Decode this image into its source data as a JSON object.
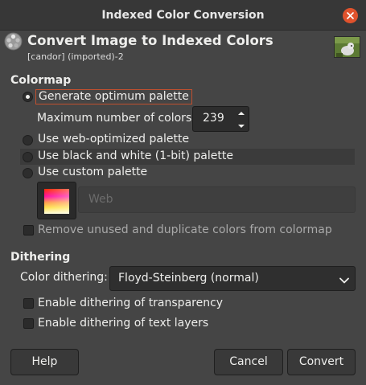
{
  "window": {
    "title": "Indexed Color Conversion"
  },
  "header": {
    "title": "Convert Image to Indexed Colors",
    "subtitle": "[candor] (imported)-2"
  },
  "colormap": {
    "section_label": "Colormap",
    "options": [
      {
        "label": "Generate optimum palette",
        "checked": true
      },
      {
        "label": "Use web-optimized palette",
        "checked": false
      },
      {
        "label": "Use black and white (1-bit) palette",
        "checked": false
      },
      {
        "label": "Use custom palette",
        "checked": false
      }
    ],
    "max_colors_label": "Maximum number of colors:",
    "max_colors_value": "239",
    "custom_palette_name": "Web",
    "remove_unused_label": "Remove unused and duplicate colors from colormap"
  },
  "dithering": {
    "section_label": "Dithering",
    "color_dithering_label": "Color dithering:",
    "color_dithering_value": "Floyd-Steinberg (normal)",
    "transparency_label": "Enable dithering of transparency",
    "text_layers_label": "Enable dithering of text layers"
  },
  "buttons": {
    "help": "Help",
    "cancel": "Cancel",
    "convert": "Convert"
  },
  "colors": {
    "accent": "#e0522c",
    "background": "#454545",
    "focus_border": "#c0502f"
  },
  "icons": {
    "close": "close-icon",
    "header": "gimp-convert-indexed-icon",
    "spin_up": "chevron-up-icon",
    "spin_down": "chevron-down-icon",
    "combo": "chevron-down-icon"
  }
}
